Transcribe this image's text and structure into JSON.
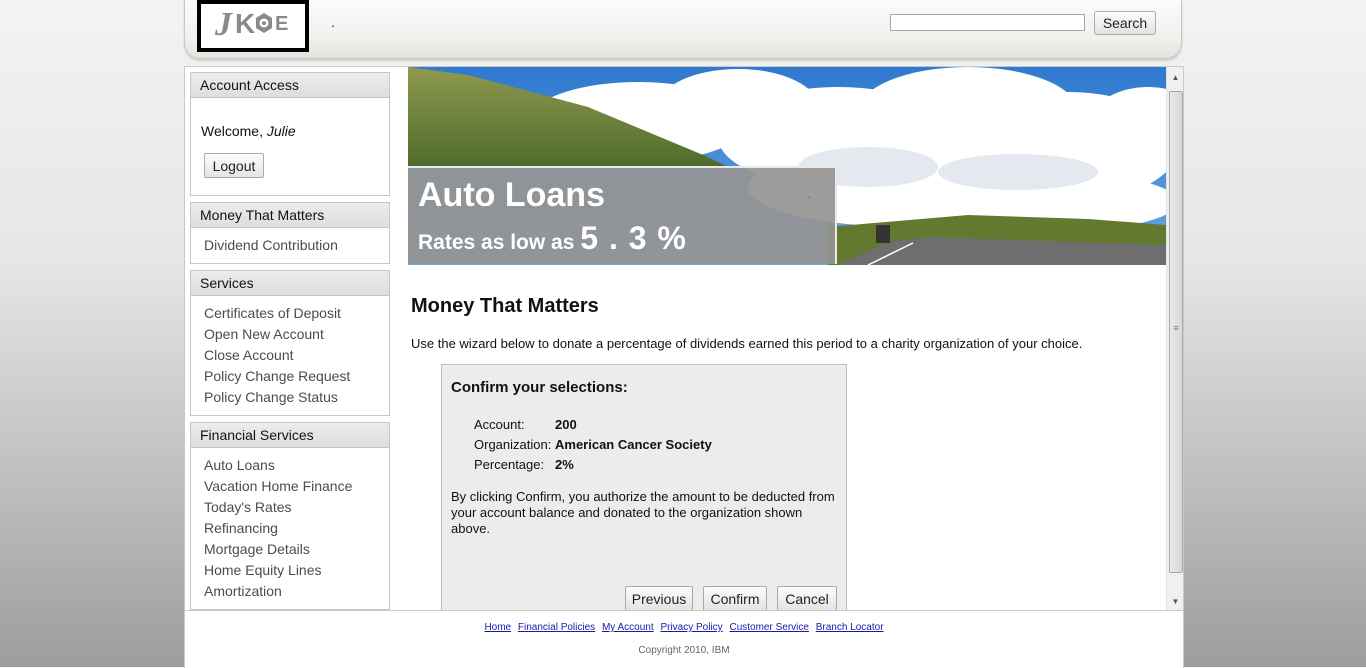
{
  "header": {
    "logo_text": "JKE",
    "dot": ".",
    "search_placeholder": "",
    "search_label": "Search"
  },
  "sidebar": {
    "account_access": {
      "title": "Account Access",
      "welcome_prefix": "Welcome, ",
      "user": "Julie",
      "logout_label": "Logout"
    },
    "money": {
      "title": "Money That Matters",
      "items": [
        "Dividend Contribution"
      ]
    },
    "services": {
      "title": "Services",
      "items": [
        "Certificates of Deposit",
        "Open New Account",
        "Close Account",
        "Policy Change Request",
        "Policy Change Status"
      ]
    },
    "financial": {
      "title": "Financial Services",
      "items": [
        "Auto Loans",
        "Vacation Home Finance",
        "Today's Rates",
        "Refinancing",
        "Mortgage Details",
        "Home Equity Lines",
        "Amortization"
      ]
    }
  },
  "banner": {
    "title": "Auto Loans",
    "subtitle": "Rates as low as",
    "rate": "5 . 3 %",
    "dot": "."
  },
  "main": {
    "title": "Money That Matters",
    "intro": "Use the wizard below to donate a percentage of dividends earned this period to a charity organization of your choice."
  },
  "confirm": {
    "title": "Confirm your selections:",
    "rows": [
      {
        "label": "Account:",
        "value": "200"
      },
      {
        "label": "Organization:",
        "value": "American Cancer Society"
      },
      {
        "label": "Percentage:",
        "value": "2%"
      }
    ],
    "note": "By clicking Confirm, you authorize the amount to be deducted from your account balance and donated to the organization shown above.",
    "buttons": {
      "previous": "Previous",
      "confirm": "Confirm",
      "cancel": "Cancel"
    }
  },
  "footer": {
    "links": [
      "Home",
      "Financial Policies",
      "My Account",
      "Privacy Policy",
      "Customer Service",
      "Branch Locator"
    ],
    "copyright": "Copyright 2010, IBM"
  },
  "colors": {
    "link": "#1a1aa6",
    "sidebar_link": "#4c4c4c",
    "panel_bg": "#ececec",
    "banner_caption": "#969491"
  }
}
